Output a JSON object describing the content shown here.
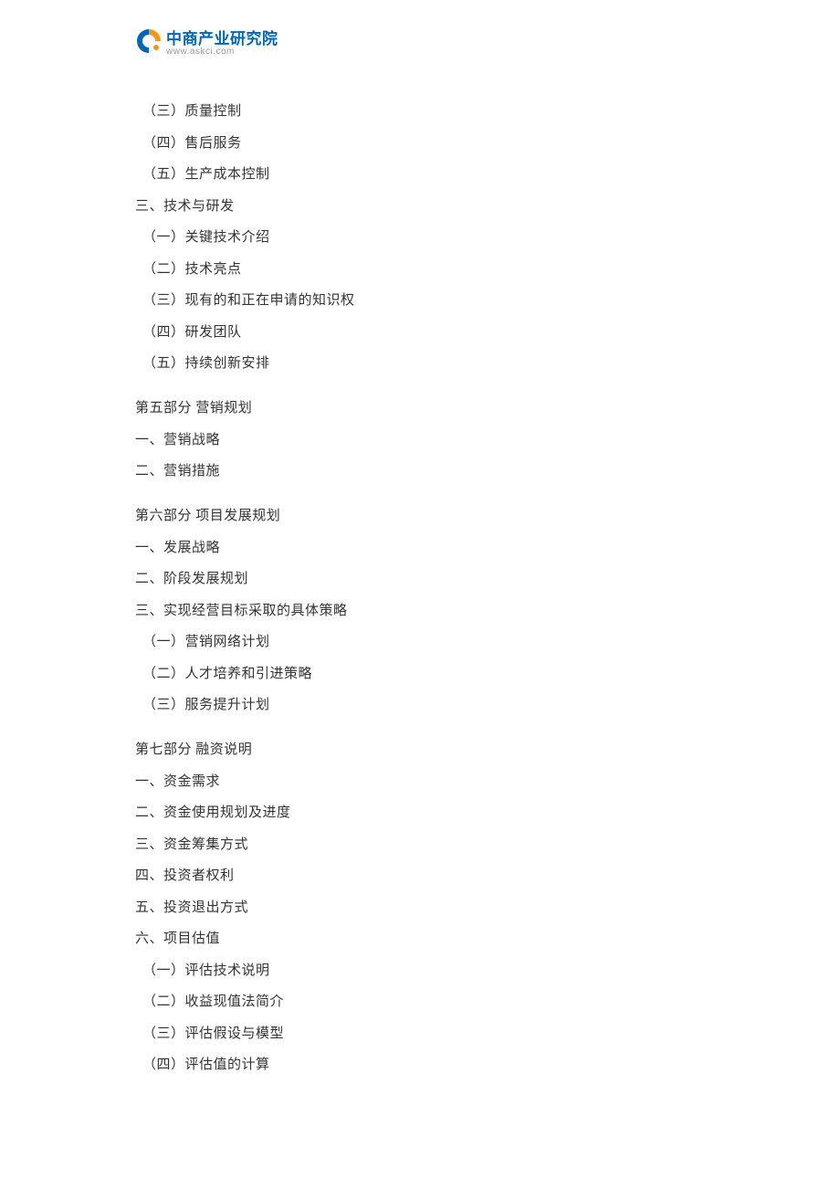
{
  "logo": {
    "name_cn": "中商产业研究院",
    "name_en": "www.askci.com"
  },
  "content": {
    "lines": [
      {
        "text": "（三）质量控制",
        "indent": true,
        "gap": false
      },
      {
        "text": "（四）售后服务",
        "indent": true,
        "gap": false
      },
      {
        "text": "（五）生产成本控制",
        "indent": true,
        "gap": false
      },
      {
        "text": "三、技术与研发",
        "indent": false,
        "gap": false
      },
      {
        "text": "（一）关键技术介绍",
        "indent": true,
        "gap": false
      },
      {
        "text": "（二）技术亮点",
        "indent": true,
        "gap": false
      },
      {
        "text": "（三）现有的和正在申请的知识权",
        "indent": true,
        "gap": false
      },
      {
        "text": "（四）研发团队",
        "indent": true,
        "gap": false
      },
      {
        "text": "（五）持续创新安排",
        "indent": true,
        "gap": false
      },
      {
        "text": "第五部分  营销规划",
        "indent": false,
        "gap": true
      },
      {
        "text": "一、营销战略",
        "indent": false,
        "gap": false
      },
      {
        "text": "二、营销措施",
        "indent": false,
        "gap": false
      },
      {
        "text": "第六部分  项目发展规划",
        "indent": false,
        "gap": true
      },
      {
        "text": "一、发展战略",
        "indent": false,
        "gap": false
      },
      {
        "text": "二、阶段发展规划",
        "indent": false,
        "gap": false
      },
      {
        "text": "三、实现经营目标采取的具体策略",
        "indent": false,
        "gap": false
      },
      {
        "text": "（一）营销网络计划",
        "indent": true,
        "gap": false
      },
      {
        "text": "（二）人才培养和引进策略",
        "indent": true,
        "gap": false
      },
      {
        "text": "（三）服务提升计划",
        "indent": true,
        "gap": false
      },
      {
        "text": "第七部分  融资说明",
        "indent": false,
        "gap": true
      },
      {
        "text": "一、资金需求",
        "indent": false,
        "gap": false
      },
      {
        "text": "二、资金使用规划及进度",
        "indent": false,
        "gap": false
      },
      {
        "text": "三、资金筹集方式",
        "indent": false,
        "gap": false
      },
      {
        "text": "四、投资者权利",
        "indent": false,
        "gap": false
      },
      {
        "text": "五、投资退出方式",
        "indent": false,
        "gap": false
      },
      {
        "text": "六、项目估值",
        "indent": false,
        "gap": false
      },
      {
        "text": "（一）评估技术说明",
        "indent": true,
        "gap": false
      },
      {
        "text": "（二）收益现值法简介",
        "indent": true,
        "gap": false
      },
      {
        "text": "（三）评估假设与模型",
        "indent": true,
        "gap": false
      },
      {
        "text": "（四）评估值的计算",
        "indent": true,
        "gap": false
      }
    ]
  }
}
